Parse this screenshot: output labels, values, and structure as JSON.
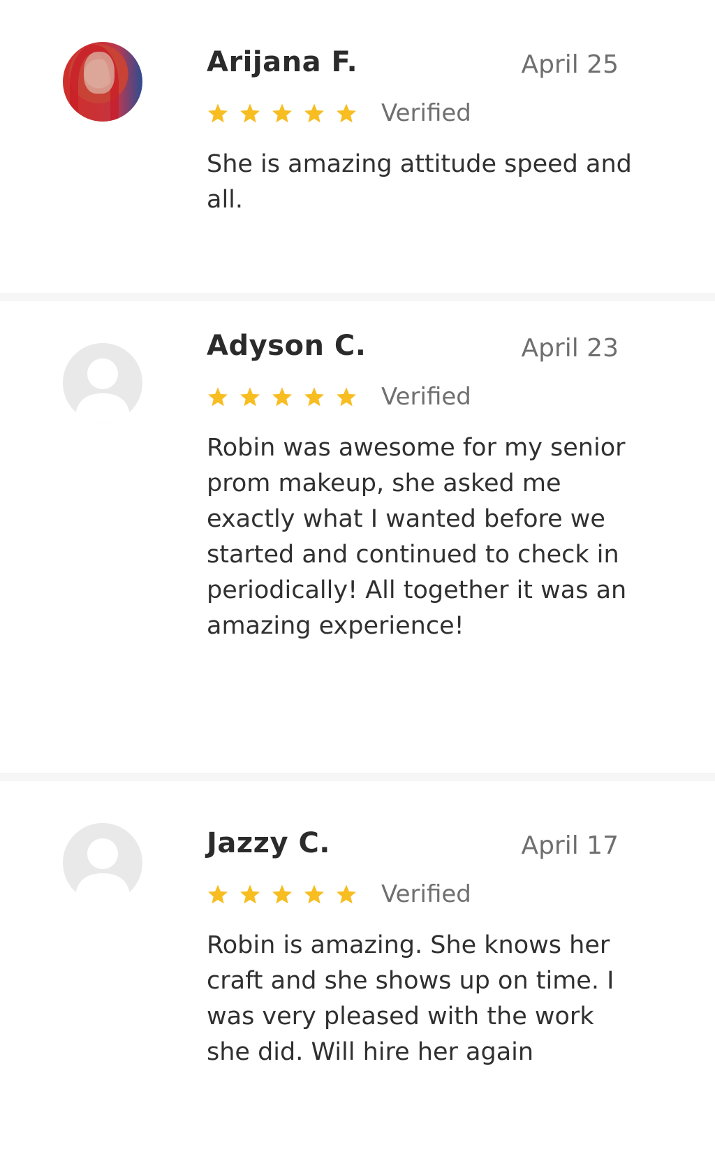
{
  "colors": {
    "star": "#F7BD21",
    "name": "#2B2B2B",
    "meta": "#6F6F6F",
    "divider": "#F6F6F6",
    "avatar_placeholder": "#E9E9E9"
  },
  "reviews": [
    {
      "name": "Arijana F.",
      "date": "April 25",
      "rating": 5,
      "verified": "Verified",
      "avatar": "user-photo",
      "text": "She is amazing attitude speed and all."
    },
    {
      "name": "Adyson C.",
      "date": "April 23",
      "rating": 5,
      "verified": "Verified",
      "avatar": "default-user-icon",
      "text": "Robin was awesome for my senior prom makeup, she asked me exactly what I wanted before we started and continued to check in periodically! All together it was an amazing experience!"
    },
    {
      "name": "Jazzy C.",
      "date": "April 17",
      "rating": 5,
      "verified": "Verified",
      "avatar": "default-user-icon",
      "text": "Robin is amazing. She knows her craft and she shows up on time. I was very pleased with the work she did. Will hire her again"
    }
  ]
}
